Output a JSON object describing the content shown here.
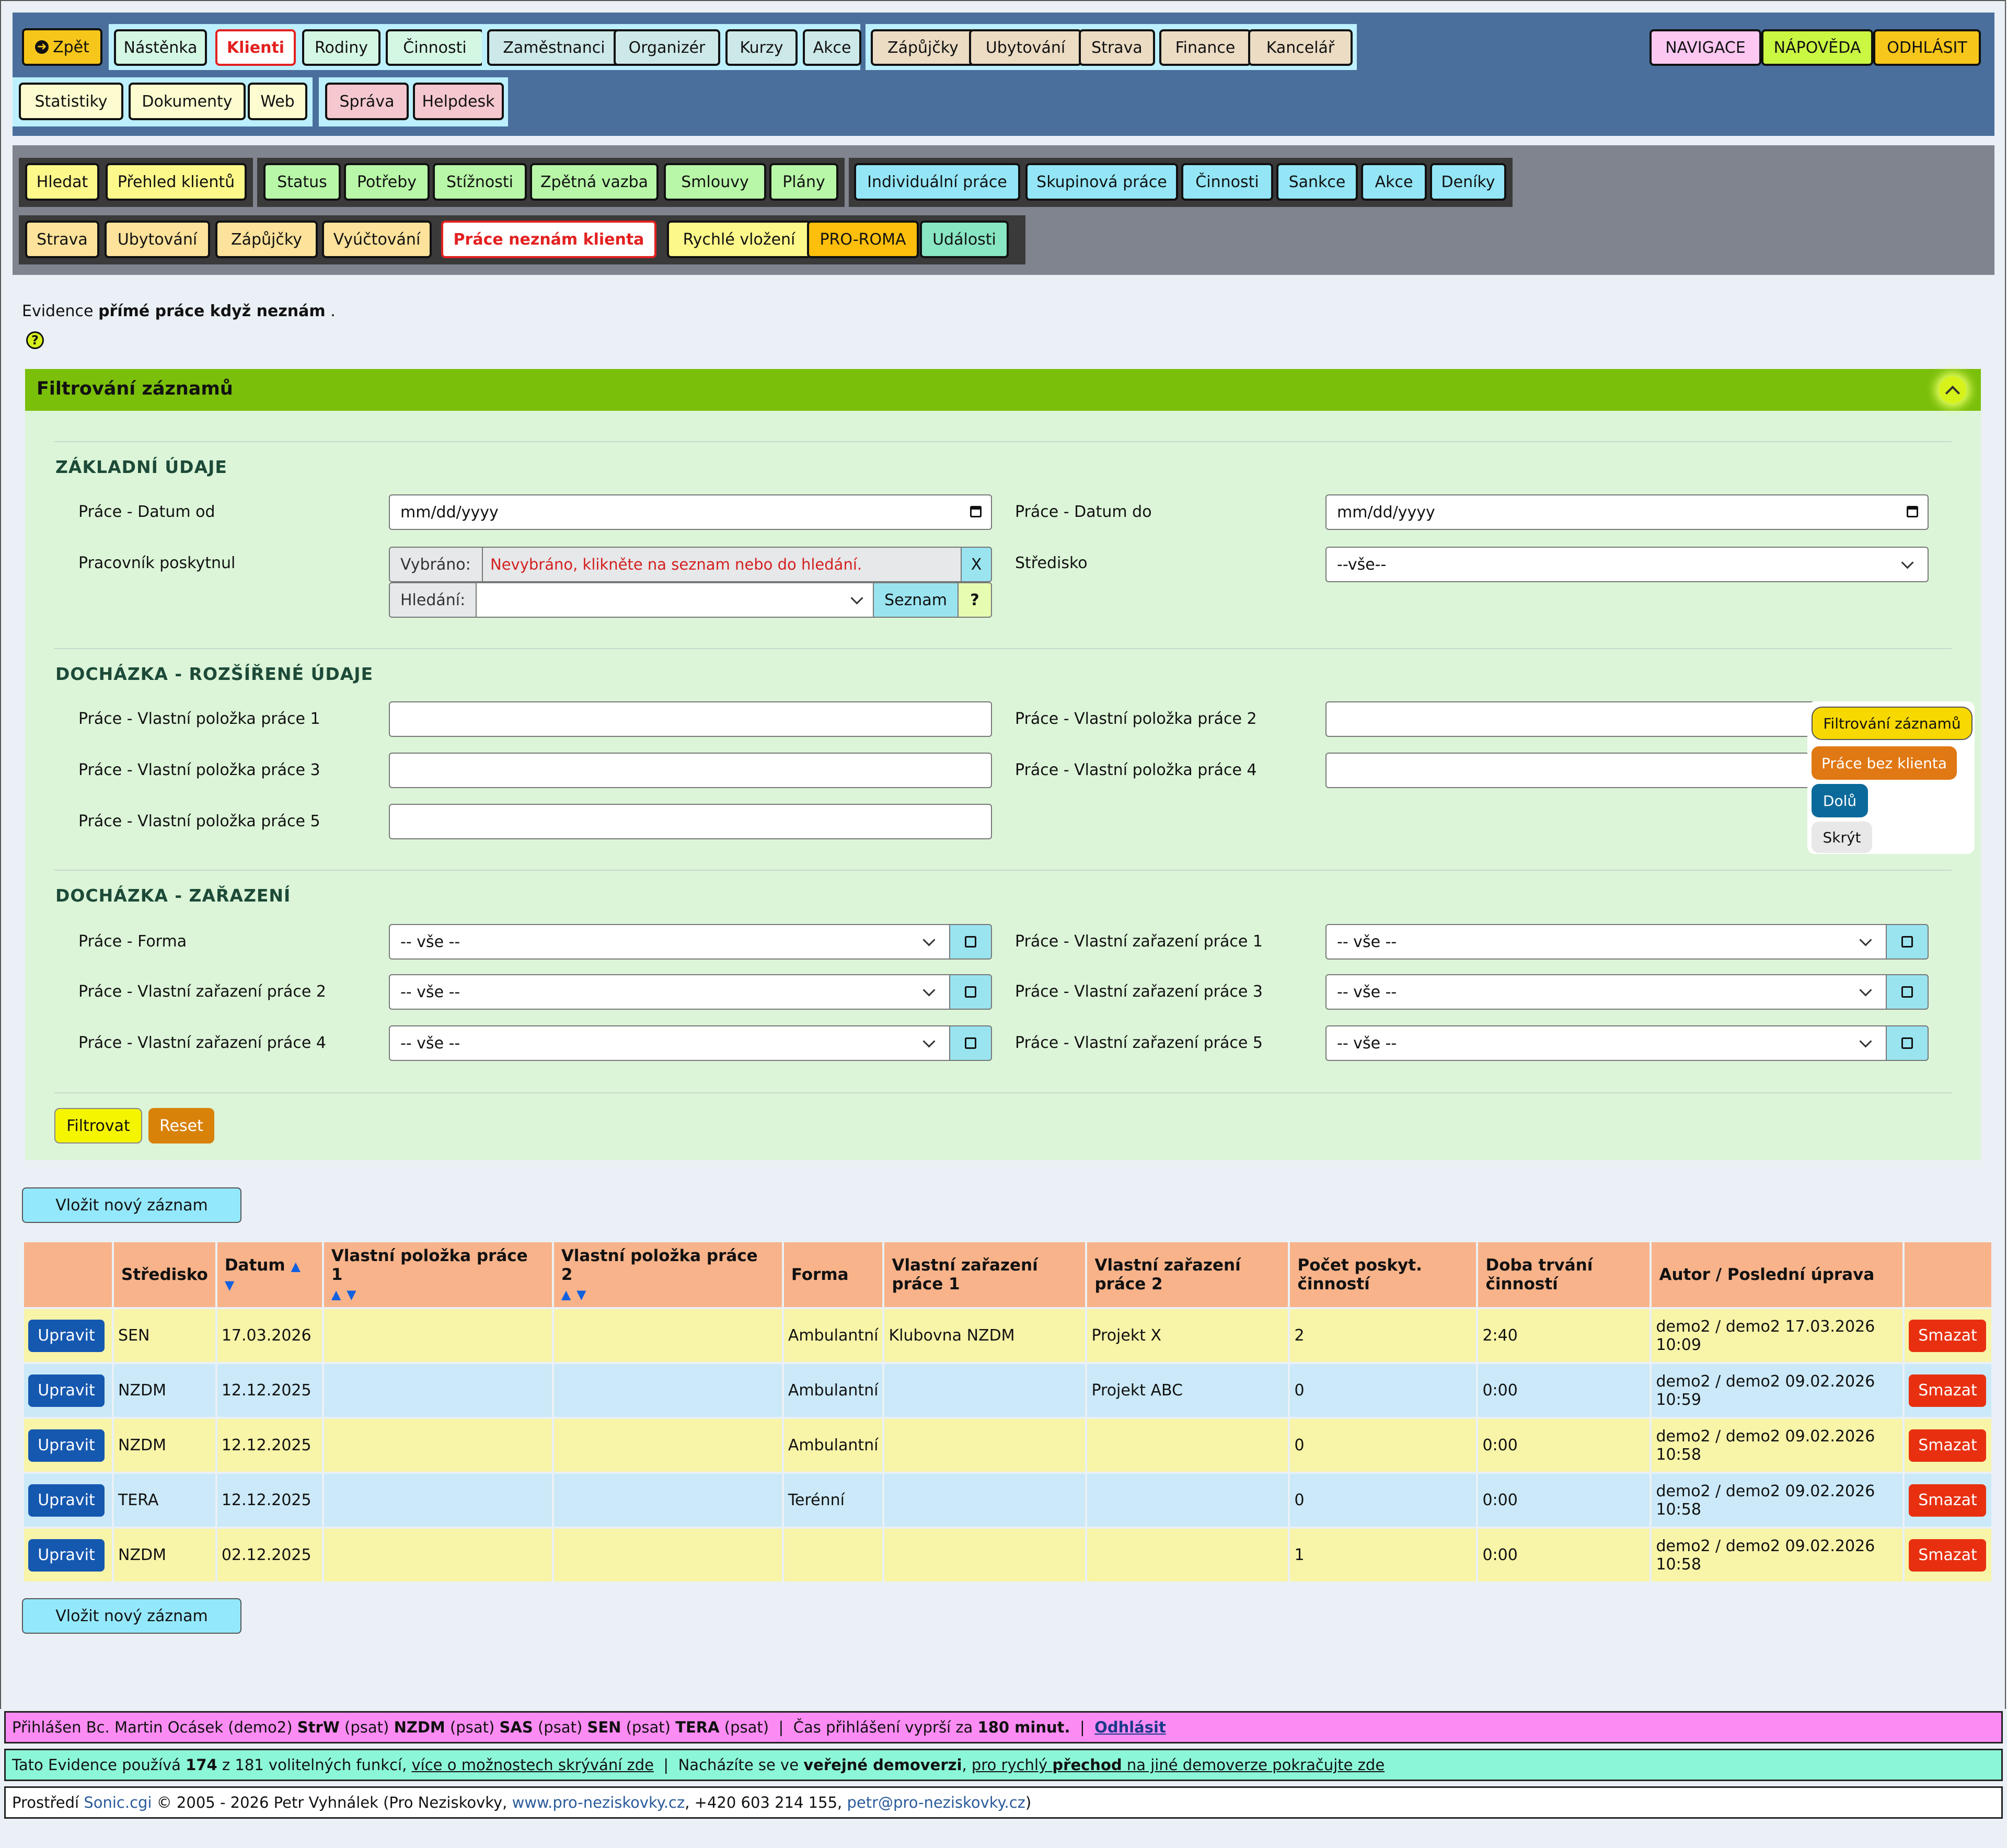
{
  "topnav": {
    "back": "Zpět",
    "row1": [
      "Nástěnka",
      "Klienti",
      "Rodiny",
      "Činnosti",
      "Zaměstnanci",
      "Organizér",
      "Kurzy",
      "Akce",
      "Zápůjčky",
      "Ubytování",
      "Strava",
      "Finance",
      "Kancelář"
    ],
    "row2": [
      "Statistiky",
      "Dokumenty",
      "Web",
      "Správa",
      "Helpdesk"
    ],
    "right": [
      "NAVIGACE",
      "NÁPOVĚDA",
      "ODHLÁSIT"
    ]
  },
  "subnav": {
    "row1": [
      "Hledat",
      "Přehled klientů",
      "Status",
      "Potřeby",
      "Stížnosti",
      "Zpětná vazba",
      "Smlouvy",
      "Plány",
      "Individuální práce",
      "Skupinová práce",
      "Činnosti",
      "Sankce",
      "Akce",
      "Deníky"
    ],
    "row2": [
      "Strava",
      "Ubytování",
      "Zápůjčky",
      "Vyúčtování",
      "Práce neznám klienta",
      "Rychlé vložení",
      "PRO-ROMA",
      "Události"
    ]
  },
  "intro": {
    "prefix": "Evidence",
    "bold": "přímé práce když neznám",
    "suffix": "."
  },
  "filter": {
    "title": "Filtrování záznamů",
    "s1": "ZÁKLADNÍ ÚDAJE",
    "date_from_label": "Práce - Datum od",
    "date_to_label": "Práce - Datum do",
    "date_placeholder": "mm/dd/yyyy",
    "worker_label": "Pracovník poskytnul",
    "selected_label": "Vybráno:",
    "selected_value": "Nevybráno, klikněte na seznam nebo do hledání.",
    "clear": "X",
    "search_label": "Hledání:",
    "list_btn": "Seznam",
    "help_btn": "?",
    "center_label": "Středisko",
    "center_value": "--vše--",
    "s2": "DOCHÁZKA - ROZŠÍŘENÉ ÚDAJE",
    "custom": [
      "Práce - Vlastní položka práce 1",
      "Práce - Vlastní položka práce 2",
      "Práce - Vlastní položka práce 3",
      "Práce - Vlastní položka práce 4",
      "Práce - Vlastní položka práce 5"
    ],
    "s3": "DOCHÁZKA - ZAŘAZENÍ",
    "class_labels": [
      "Práce - Forma",
      "Práce - Vlastní zařazení práce 1",
      "Práce - Vlastní zařazení práce 2",
      "Práce - Vlastní zařazení práce 3",
      "Práce - Vlastní zařazení práce 4",
      "Práce - Vlastní zařazení práce 5"
    ],
    "all": "-- vše --",
    "filter_btn": "Filtrovat",
    "reset_btn": "Reset"
  },
  "floating": [
    "Filtrování záznamů",
    "Práce bez klienta",
    "Dolů",
    "Skrýt"
  ],
  "insert_btn": "Vložit nový záznam",
  "table": {
    "headers": [
      "Středisko",
      "Datum",
      "Vlastní položka práce 1",
      "Vlastní položka práce 2",
      "Forma",
      "Vlastní zařazení práce 1",
      "Vlastní zařazení práce 2",
      "Počet poskyt. činností",
      "Doba trvání činností",
      "Autor / Poslední úprava"
    ],
    "edit": "Upravit",
    "delete": "Smazat",
    "rows": [
      {
        "c": "SEN",
        "d": "17.03.2026",
        "p1": "",
        "p2": "",
        "f": "Ambulantní",
        "z1": "Klubovna NZDM",
        "z2": "Projekt X",
        "n": "2",
        "t": "2:40",
        "a": "demo2 / demo2 17.03.2026 10:09"
      },
      {
        "c": "NZDM",
        "d": "12.12.2025",
        "p1": "",
        "p2": "",
        "f": "Ambulantní",
        "z1": "",
        "z2": "Projekt ABC",
        "n": "0",
        "t": "0:00",
        "a": "demo2 / demo2 09.02.2026 10:59"
      },
      {
        "c": "NZDM",
        "d": "12.12.2025",
        "p1": "",
        "p2": "",
        "f": "Ambulantní",
        "z1": "",
        "z2": "",
        "n": "0",
        "t": "0:00",
        "a": "demo2 / demo2 09.02.2026 10:58"
      },
      {
        "c": "TERA",
        "d": "12.12.2025",
        "p1": "",
        "p2": "",
        "f": "Terénní",
        "z1": "",
        "z2": "",
        "n": "0",
        "t": "0:00",
        "a": "demo2 / demo2 09.02.2026 10:58"
      },
      {
        "c": "NZDM",
        "d": "02.12.2025",
        "p1": "",
        "p2": "",
        "f": "",
        "z1": "",
        "z2": "",
        "n": "1",
        "t": "0:00",
        "a": "demo2 / demo2 09.02.2026 10:58"
      }
    ]
  },
  "footer": {
    "l1": {
      "a": "Přihlášen Bc. Martin Ocásek (demo2)",
      "b1": "StrW",
      "p1": "(psat)",
      "b2": "NZDM",
      "p2": "(psat)",
      "b3": "SAS",
      "p3": "(psat)",
      "b4": "SEN",
      "p4": "(psat)",
      "b5": "TERA",
      "p5": "(psat)",
      "sep": "|",
      "exp": "Čas přihlášení vyprší za",
      "mins": "180 minut.",
      "logout": "Odhlásit"
    },
    "l2": {
      "a": "Tato Evidence používá",
      "n": "174",
      "b": "z 181 volitelných funkcí,",
      "link": "více o možnostech skrývání zde",
      "sep": "|",
      "c": "Nacházíte se ve",
      "pub": "veřejné demoverzi",
      "d": "pro rychlý",
      "prechod": "přechod",
      "e": "na jiné demoverze pokračujte zde"
    },
    "l3": {
      "a": "Prostředí",
      "sonic": "Sonic.cgi",
      "b": "© 2005 - 2026 Petr Vyhnálek (Pro Neziskovky,",
      "web": "www.pro-neziskovky.cz",
      "c": ", +420 603 214 155,",
      "mail": "petr@pro-neziskovky.cz",
      "d": ")"
    }
  },
  "colors": {
    "topbar": "#4a6f9c",
    "subbar": "#7f848e",
    "filter_head": "#7abf0a",
    "filter_body": "#dcf5d8",
    "th": "#f8b38a"
  }
}
